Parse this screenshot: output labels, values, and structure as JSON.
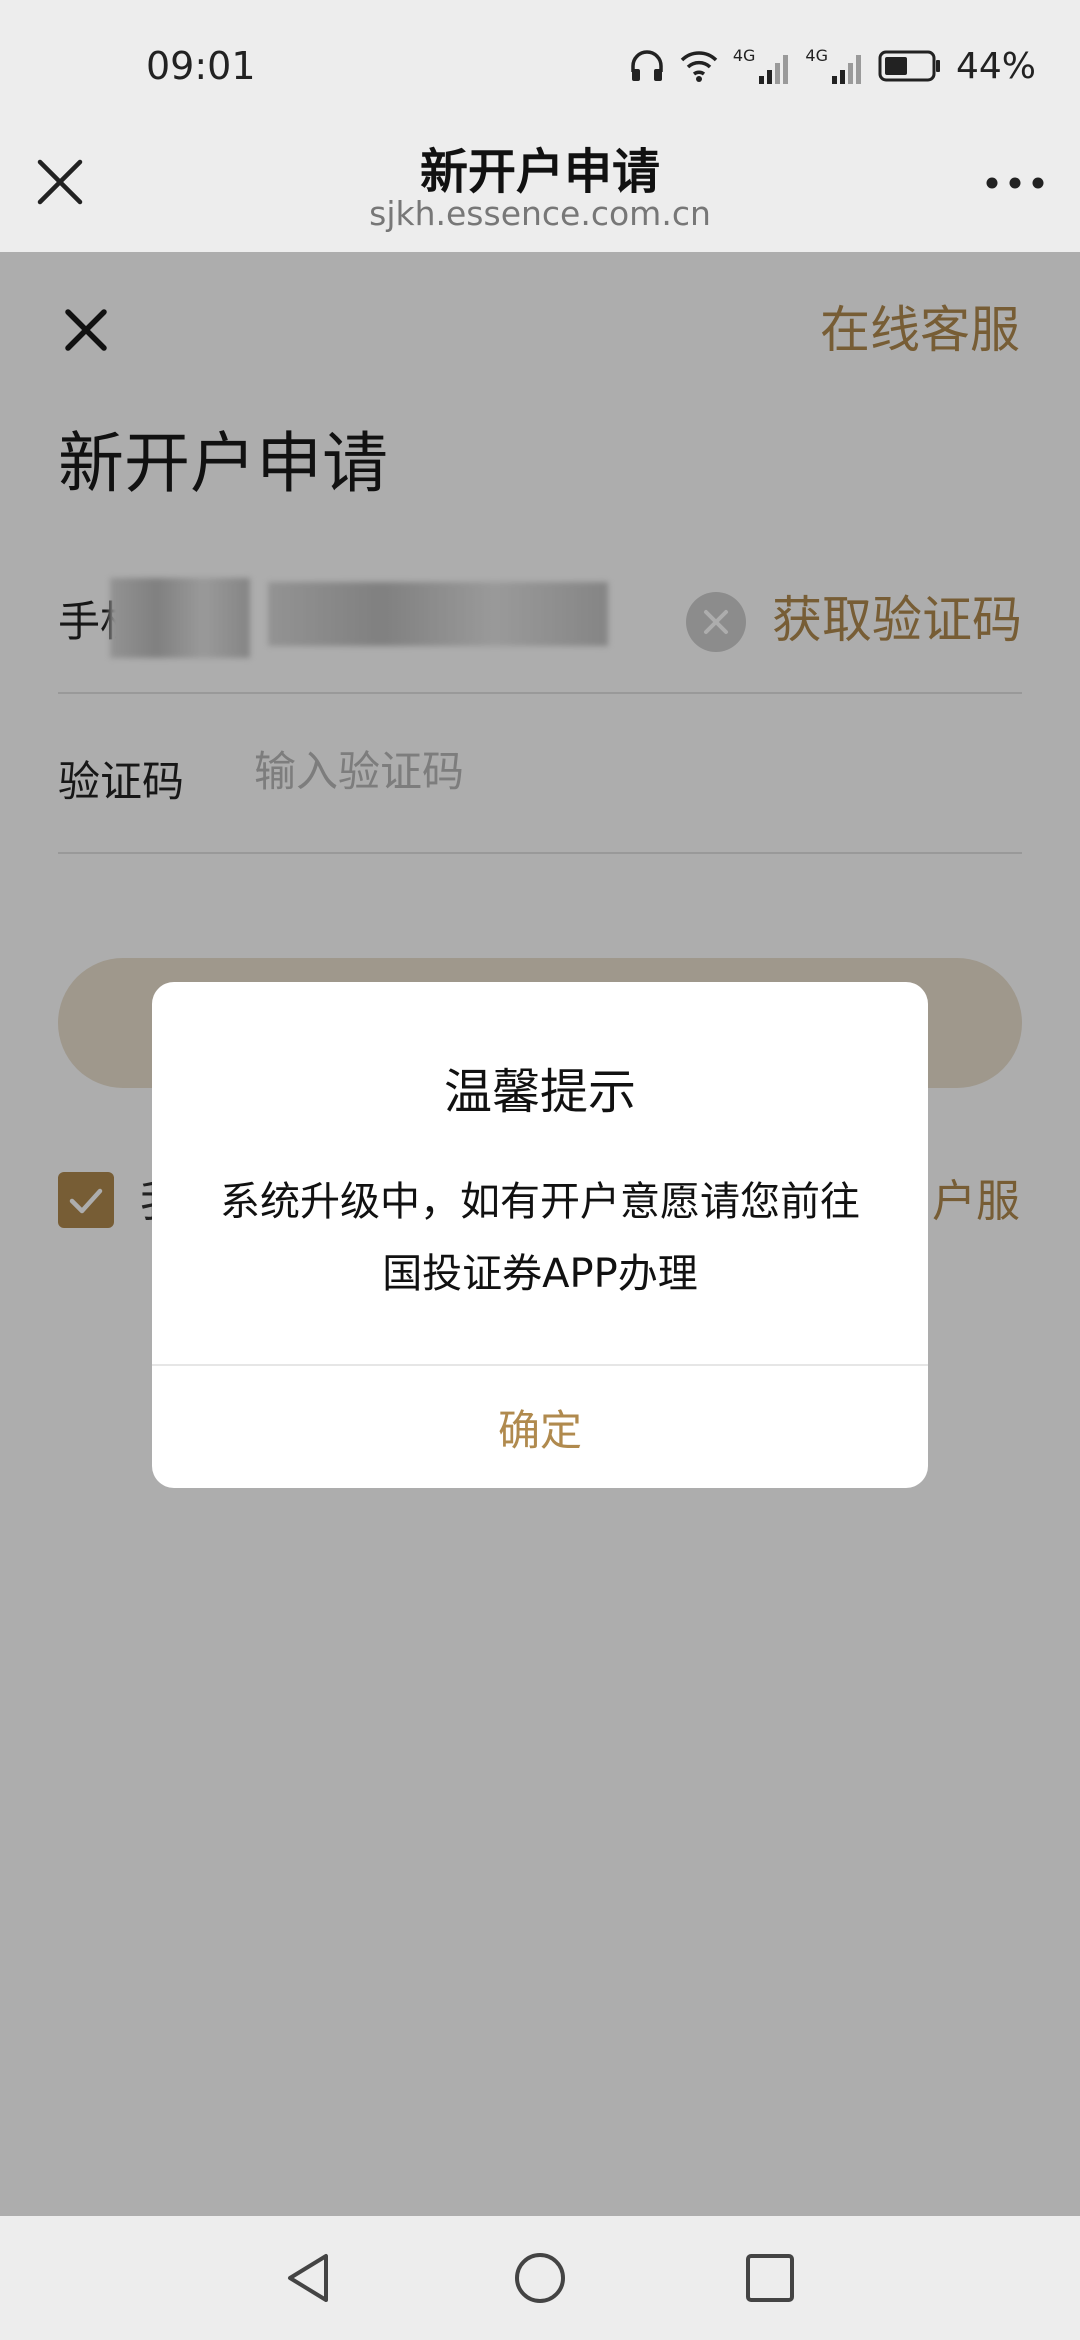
{
  "status_bar": {
    "time": "09:01",
    "battery_percent": "44%",
    "network_label": "4G",
    "icons": [
      "headphones-icon",
      "wifi-icon",
      "signal-4g-icon",
      "signal-4g-icon",
      "battery-icon"
    ]
  },
  "browser": {
    "title": "新开户申请",
    "url": "sjkh.essence.com.cn",
    "icons": [
      "close-icon",
      "more-icon"
    ]
  },
  "page": {
    "online_service": "在线客服",
    "heading": "新开户申请",
    "phone_label": "手机",
    "phone_value": "41237",
    "get_code": "获取验证码",
    "code_label": "验证码",
    "code_placeholder": "输入验证码",
    "agree_text": "我",
    "agree_link": "户服"
  },
  "dialog": {
    "title": "温馨提示",
    "message": "系统升级中，如有开户意愿请您前往国投证券APP办理",
    "confirm": "确定"
  },
  "colors": {
    "accent": "#b08a4e",
    "mask": "rgba(0,0,0,0.32)",
    "chrome": "#ededed"
  },
  "nav": {
    "icons": [
      "back-icon",
      "home-icon",
      "recents-icon"
    ]
  }
}
